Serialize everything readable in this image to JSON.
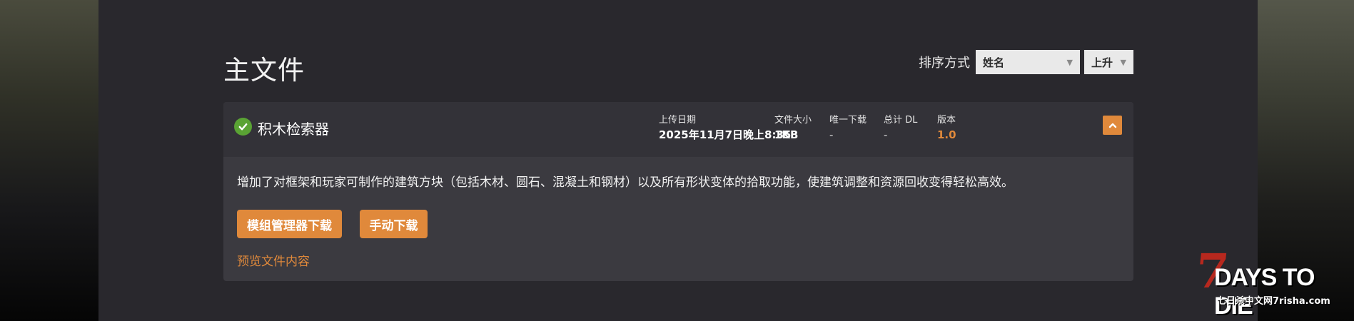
{
  "section": {
    "title": "主文件"
  },
  "sort": {
    "label": "排序方式",
    "sort_by_value": "姓名",
    "order_value": "上升"
  },
  "file": {
    "name": "积木检索器",
    "status": "verified",
    "upload_date": {
      "label": "上传日期",
      "value": "2025年11月7日晚上8:35"
    },
    "file_size": {
      "label": "文件大小",
      "value": "1KB"
    },
    "unique_downloads": {
      "label": "唯一下载",
      "value": "-"
    },
    "total_downloads": {
      "label": "总计 DL",
      "value": "-"
    },
    "version": {
      "label": "版本",
      "value": "1.0"
    },
    "description": "增加了对框架和玩家可制作的建筑方块（包括木材、圆石、混凝土和钢材）以及所有形状变体的拾取功能，使建筑调整和资源回收变得轻松高效。",
    "buttons": {
      "mod_manager_download": "模组管理器下载",
      "manual_download": "手动下载"
    },
    "preview_link": "预览文件内容"
  },
  "watermark": {
    "logo_text": "7 DAYS TO DIE",
    "site_text": "七日杀中文网7risha.com"
  },
  "colors": {
    "accent": "#e0893b",
    "panel": "#3b3a40",
    "panel_header": "#333238",
    "page_bg": "#29282d",
    "verified_green": "#5aa334"
  },
  "icons": {
    "status": "check-circle-icon",
    "collapse": "chevron-up-icon",
    "dropdown": "caret-down-icon"
  }
}
